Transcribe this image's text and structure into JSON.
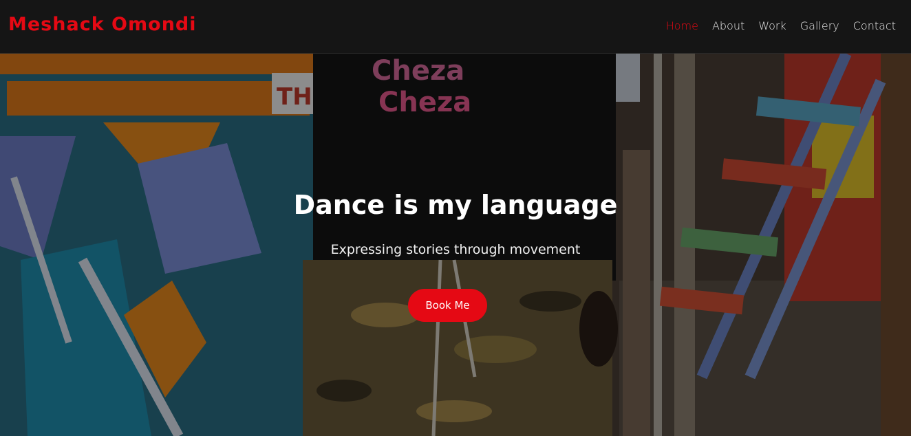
{
  "brand": {
    "name": "Meshack Omondi",
    "color": "#e50914"
  },
  "nav": {
    "items": [
      {
        "label": "Home",
        "active": true
      },
      {
        "label": "About",
        "active": false
      },
      {
        "label": "Work",
        "active": false
      },
      {
        "label": "Gallery",
        "active": false
      },
      {
        "label": "Contact",
        "active": false
      }
    ]
  },
  "hero": {
    "title": "Dance is my language",
    "subtitle": "Expressing stories through movement",
    "cta_label": "Book Me",
    "shirt_text": [
      "Cheza",
      "Cheza"
    ],
    "sign_text": "TH"
  },
  "colors": {
    "accent": "#e50914",
    "navbar_bg": "#151515",
    "text": "#ffffff"
  }
}
